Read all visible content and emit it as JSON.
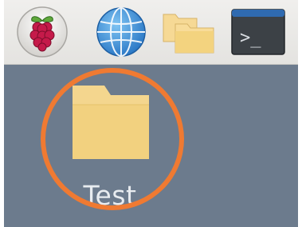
{
  "taskbar": {
    "launchers": [
      {
        "icon": "raspberry-menu-icon"
      },
      {
        "icon": "web-browser-globe-icon"
      },
      {
        "icon": "file-manager-folders-icon"
      },
      {
        "icon": "terminal-icon",
        "glyph": ">_"
      }
    ]
  },
  "desktop": {
    "background_color": "#6c7b8d",
    "folder": {
      "label": "Test",
      "icon": "folder-icon",
      "color": "#f5d88c"
    },
    "annotation": {
      "type": "circle-highlight",
      "color": "#ef7a32"
    }
  }
}
